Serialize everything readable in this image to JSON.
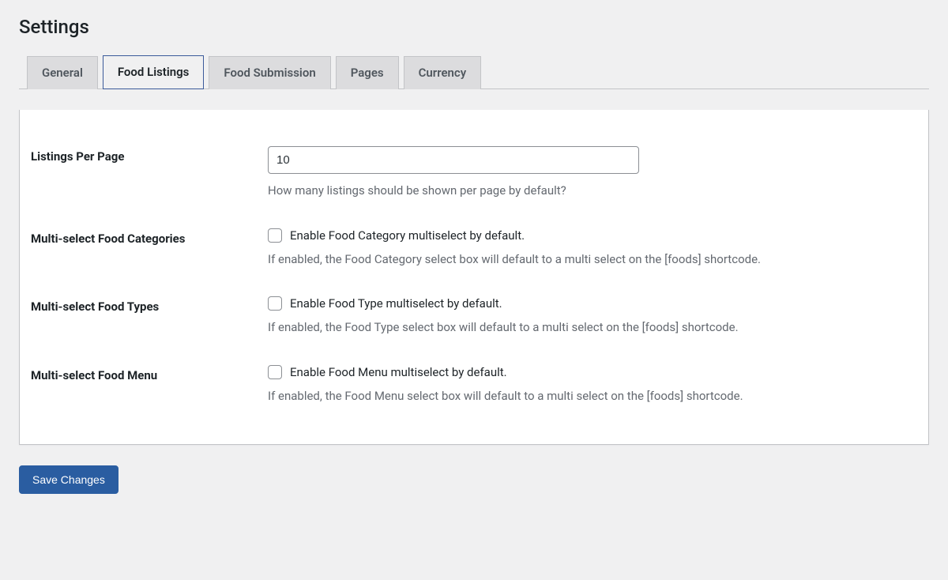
{
  "page_title": "Settings",
  "tabs": [
    {
      "label": "General",
      "active": false
    },
    {
      "label": "Food Listings",
      "active": true
    },
    {
      "label": "Food Submission",
      "active": false
    },
    {
      "label": "Pages",
      "active": false
    },
    {
      "label": "Currency",
      "active": false
    }
  ],
  "fields": {
    "listings_per_page": {
      "label": "Listings Per Page",
      "value": "10",
      "description": "How many listings should be shown per page by default?"
    },
    "multi_categories": {
      "label": "Multi-select Food Categories",
      "checkbox_label": "Enable Food Category multiselect by default.",
      "description": "If enabled, the Food Category select box will default to a multi select on the [foods] shortcode."
    },
    "multi_types": {
      "label": "Multi-select Food Types",
      "checkbox_label": "Enable Food Type multiselect by default.",
      "description": "If enabled, the Food Type select box will default to a multi select on the [foods] shortcode."
    },
    "multi_menu": {
      "label": "Multi-select Food Menu",
      "checkbox_label": "Enable Food Menu multiselect by default.",
      "description": "If enabled, the Food Menu select box will default to a multi select on the [foods] shortcode."
    }
  },
  "submit_label": "Save Changes"
}
